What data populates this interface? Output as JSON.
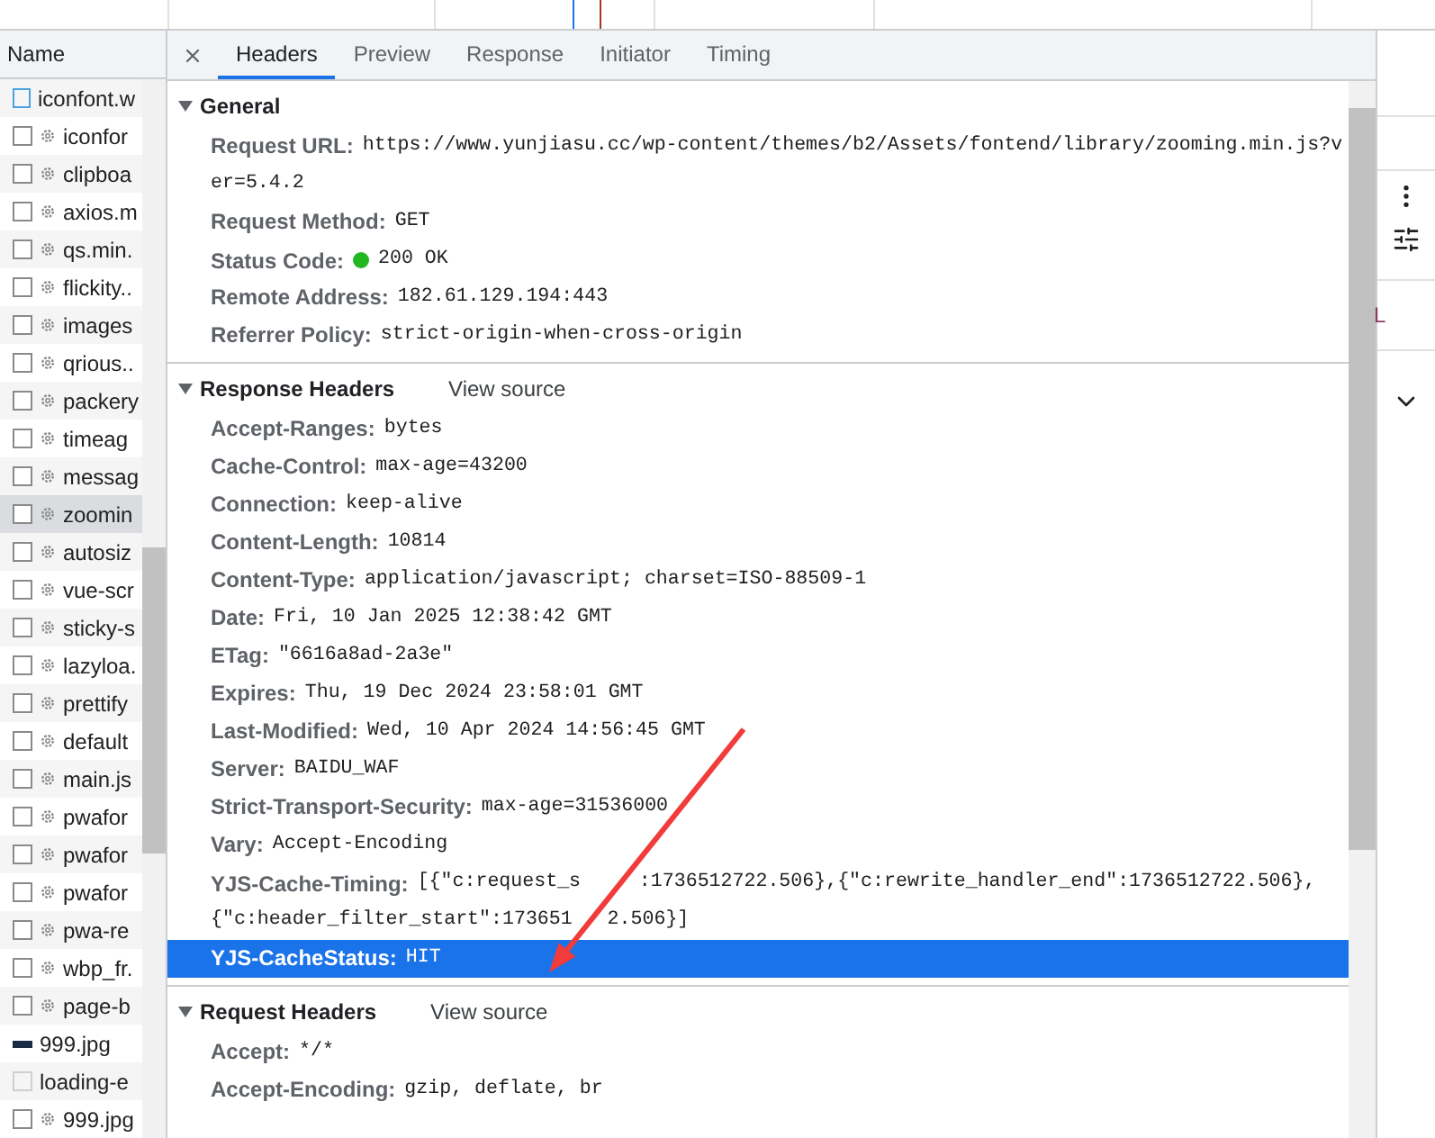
{
  "sidebar": {
    "column_header": "Name",
    "items": [
      {
        "name": "iconfont.w",
        "kind": "font",
        "selected": false
      },
      {
        "name": "iconfor",
        "kind": "script",
        "selected": false
      },
      {
        "name": "clipboa",
        "kind": "script",
        "selected": false
      },
      {
        "name": "axios.m",
        "kind": "script",
        "selected": false
      },
      {
        "name": "qs.min.",
        "kind": "script",
        "selected": false
      },
      {
        "name": "flickity..",
        "kind": "script",
        "selected": false
      },
      {
        "name": "images",
        "kind": "script",
        "selected": false
      },
      {
        "name": "qrious..",
        "kind": "script",
        "selected": false
      },
      {
        "name": "packery",
        "kind": "script",
        "selected": false
      },
      {
        "name": "timeag",
        "kind": "script",
        "selected": false
      },
      {
        "name": "messag",
        "kind": "script",
        "selected": false
      },
      {
        "name": "zoomin",
        "kind": "script",
        "selected": true
      },
      {
        "name": "autosiz",
        "kind": "script",
        "selected": false
      },
      {
        "name": "vue-scr",
        "kind": "script",
        "selected": false
      },
      {
        "name": "sticky-s",
        "kind": "script",
        "selected": false
      },
      {
        "name": "lazyloa.",
        "kind": "script",
        "selected": false
      },
      {
        "name": "prettify",
        "kind": "script",
        "selected": false
      },
      {
        "name": "default",
        "kind": "script",
        "selected": false
      },
      {
        "name": "main.js",
        "kind": "script",
        "selected": false
      },
      {
        "name": "pwafor",
        "kind": "script",
        "selected": false
      },
      {
        "name": "pwafor",
        "kind": "script",
        "selected": false
      },
      {
        "name": "pwafor",
        "kind": "script",
        "selected": false
      },
      {
        "name": "pwa-re",
        "kind": "script",
        "selected": false
      },
      {
        "name": "wbp_fr.",
        "kind": "script",
        "selected": false
      },
      {
        "name": "page-b",
        "kind": "script",
        "selected": false
      },
      {
        "name": "999.jpg",
        "kind": "image",
        "selected": false
      },
      {
        "name": "loading-e",
        "kind": "placeholder",
        "selected": false
      },
      {
        "name": "999.jpg",
        "kind": "script",
        "selected": false
      }
    ]
  },
  "tabs": [
    {
      "label": "Headers",
      "selected": true
    },
    {
      "label": "Preview",
      "selected": false
    },
    {
      "label": "Response",
      "selected": false
    },
    {
      "label": "Initiator",
      "selected": false
    },
    {
      "label": "Timing",
      "selected": false
    }
  ],
  "sections": [
    {
      "title": "General",
      "expanded": true,
      "rows": [
        {
          "name": "Request URL:",
          "value": "https://www.yunjiasu.cc/wp-content/themes/b2/Assets/fontend/library/zooming.min.js?ver=5.4.2",
          "kind": "text",
          "selected": false
        },
        {
          "name": "Request Method:",
          "value": "GET",
          "kind": "text",
          "selected": false
        },
        {
          "name": "Status Code:",
          "value": "200 OK",
          "kind": "status",
          "selected": false
        },
        {
          "name": "Remote Address:",
          "value": "182.61.129.194:443",
          "kind": "text",
          "selected": false
        },
        {
          "name": "Referrer Policy:",
          "value": "strict-origin-when-cross-origin",
          "kind": "text",
          "selected": false
        }
      ]
    },
    {
      "title": "Response Headers",
      "link": "View source",
      "expanded": true,
      "rows": [
        {
          "name": "Accept-Ranges:",
          "value": "bytes",
          "kind": "text",
          "selected": false
        },
        {
          "name": "Cache-Control:",
          "value": "max-age=43200",
          "kind": "text",
          "selected": false
        },
        {
          "name": "Connection:",
          "value": "keep-alive",
          "kind": "text",
          "selected": false
        },
        {
          "name": "Content-Length:",
          "value": "10814",
          "kind": "text",
          "selected": false
        },
        {
          "name": "Content-Type:",
          "value": "application/javascript; charset=ISO-88509-1",
          "kind": "text",
          "selected": false
        },
        {
          "name": "Date:",
          "value": "Fri, 10 Jan 2025 12:38:42 GMT",
          "kind": "text",
          "selected": false
        },
        {
          "name": "ETag:",
          "value": "\"6616a8ad-2a3e\"",
          "kind": "text",
          "selected": false
        },
        {
          "name": "Expires:",
          "value": "Thu, 19 Dec 2024 23:58:01 GMT",
          "kind": "text",
          "selected": false
        },
        {
          "name": "Last-Modified:",
          "value": "Wed, 10 Apr 2024 14:56:45 GMT",
          "kind": "text",
          "selected": false
        },
        {
          "name": "Server:",
          "value": "BAIDU_WAF",
          "kind": "text",
          "selected": false
        },
        {
          "name": "Strict-Transport-Security:",
          "value": "max-age=31536000",
          "kind": "text",
          "selected": false
        },
        {
          "name": "Vary:",
          "value": "Accept-Encoding",
          "kind": "text",
          "selected": false
        },
        {
          "name": "YJS-Cache-Timing:",
          "lines": [
            [
              "[{\"c:request_s",
              ":1736512722.506},{\"c:rewrite_handler_end\":1736512722.506},"
            ],
            [
              "{\"c:header_filter_start\":173651",
              "2.506}]"
            ]
          ],
          "kind": "covered",
          "selected": false
        },
        {
          "name": "YJS-CacheStatus:",
          "value": "HIT",
          "kind": "text",
          "selected": true
        }
      ]
    },
    {
      "title": "Request Headers",
      "link": "View source",
      "expanded": true,
      "rows": [
        {
          "name": "Accept:",
          "value": "*/*",
          "kind": "text",
          "selected": false
        },
        {
          "name": "Accept-Encoding:",
          "value": "gzip, deflate, br",
          "kind": "text",
          "selected": false
        }
      ]
    }
  ],
  "right_panel": {
    "text": "L"
  }
}
